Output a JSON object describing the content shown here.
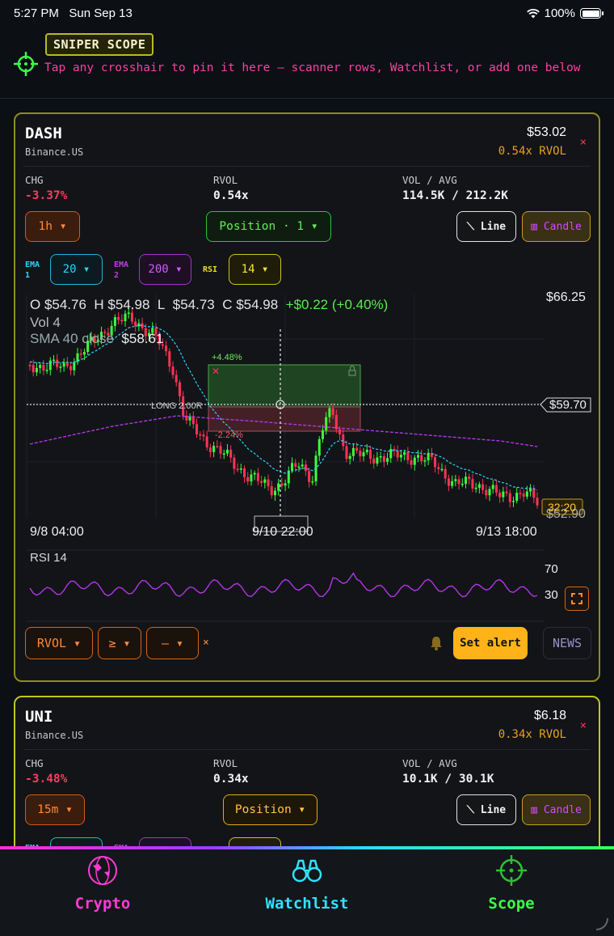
{
  "status": {
    "time": "5:27 PM",
    "date": "Sun Sep 13",
    "battery": "100%"
  },
  "header": {
    "title": "SNIPER SCOPE",
    "hint": "Tap any crosshair to pin it here — scanner rows, Watchlist, or add one below"
  },
  "cards": [
    {
      "symbol": "DASH",
      "exchange": "Binance.US",
      "price": "$53.02",
      "rvol_badge": "0.54x RVOL",
      "close": "×",
      "stats": {
        "chg_label": "CHG",
        "chg": "-3.37%",
        "rvol_label": "RVOL",
        "rvol": "0.54x",
        "vol_label": "VOL / AVG",
        "vol": "114.5K / 212.2K"
      },
      "timeframe": "1h ▾",
      "position": "Position · 1 ▾",
      "line_btn": "⟍ Line",
      "candle_btn": "▥ Candle",
      "ema1_label": "EMA\n1",
      "ema1": "20 ▾",
      "ema2_label": "EMA\n2",
      "ema2": "200 ▾",
      "rsi_label": "RSI",
      "rsi": "14 ▾",
      "ohlc": {
        "o": "$54.76",
        "h": "$54.98",
        "l": "$54.73",
        "c": "$54.98",
        "chg": "+$0.22 (+0.40%)"
      },
      "vol_text": "Vol  4",
      "sma_text": "SMA 40 close",
      "sma_value": "$58.61",
      "price_top": "$66.25",
      "price_cross": "$59.70",
      "price_bottom": "$52.90",
      "countdown": "32:20",
      "target_pct": "+4.48%",
      "stop_pct": "-2.24%",
      "position_label": "LONG 2.00R",
      "x_labels": [
        "9/8 04:00",
        "9/10 22:00",
        "9/13 18:00"
      ],
      "rsi_title": "RSI 14",
      "rsi_levels": [
        "70",
        "30"
      ],
      "filter_field": "RVOL ▾",
      "filter_op": "≥ ▾",
      "filter_val": "— ▾",
      "filter_clear": "×",
      "alert": "Set alert",
      "news": "NEWS"
    },
    {
      "symbol": "UNI",
      "exchange": "Binance.US",
      "price": "$6.18",
      "rvol_badge": "0.34x RVOL",
      "close": "×",
      "stats": {
        "chg_label": "CHG",
        "chg": "-3.48%",
        "rvol_label": "RVOL",
        "rvol": "0.34x",
        "vol_label": "VOL / AVG",
        "vol": "10.1K / 30.1K"
      },
      "timeframe": "15m ▾",
      "position": "Position ▾",
      "line_btn": "⟍ Line",
      "candle_btn": "▥ Candle",
      "ema1_label": "EMA",
      "ema2_label": "EMA"
    }
  ],
  "tabs": [
    {
      "label": "Crypto",
      "color": "#ff3ad6"
    },
    {
      "label": "Watchlist",
      "color": "#2ee3ff"
    },
    {
      "label": "Scope",
      "color": "#39ff4a"
    }
  ],
  "colors": {
    "bull": "#3cff3c",
    "bear": "#ff3355",
    "ema20": "#2ad4ff",
    "ema200": "#b535e6",
    "rsi": "#b535e6"
  }
}
